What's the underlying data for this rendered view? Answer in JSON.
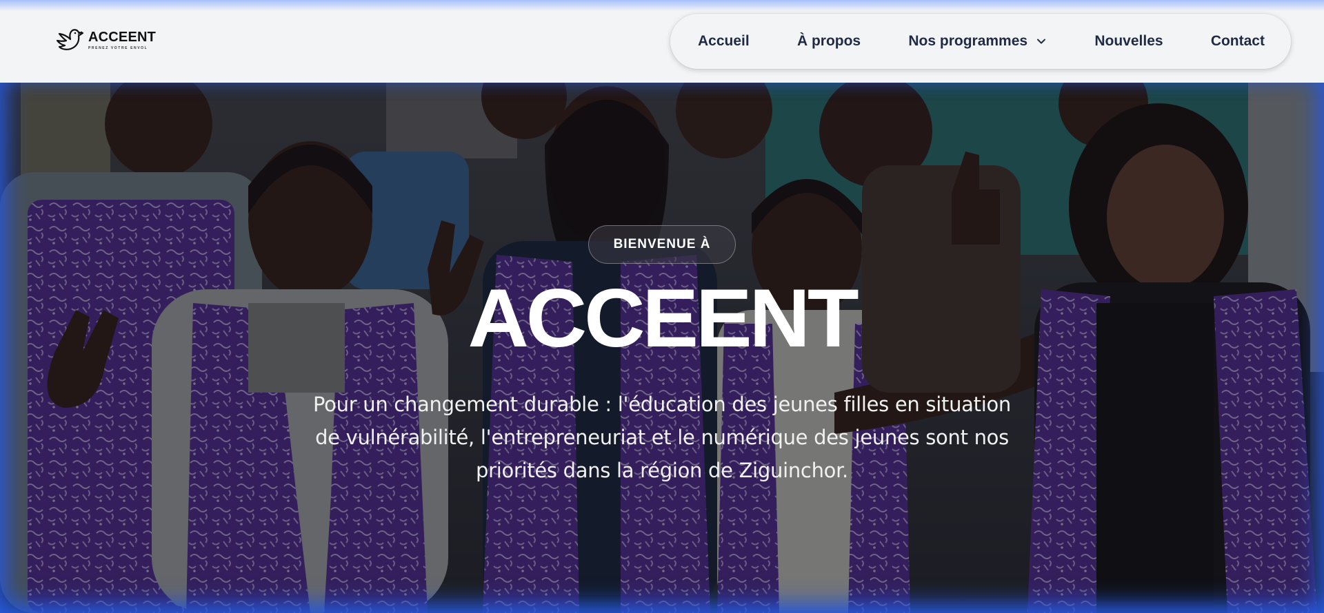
{
  "header": {
    "logo": {
      "name": "ACCEENT",
      "tagline": "PRENEZ VOTRE ENVOL",
      "icon": "dove-icon"
    },
    "nav": [
      {
        "label": "Accueil"
      },
      {
        "label": "À propos"
      },
      {
        "label": "Nos programmes",
        "icon": "chevron-down-icon"
      },
      {
        "label": "Nouvelles"
      },
      {
        "label": "Contact"
      }
    ]
  },
  "hero": {
    "badge": "BIENVENUE À",
    "title": "ACCEENT",
    "subtitle": "Pour un changement durable : l'éducation des jeunes filles en situation de vulnérabilité, l'entrepreneuriat et le numérique des jeunes sont nos priorités dans la région de Ziguinchor.",
    "image": "group-photo"
  },
  "colors": {
    "header_bg": "#f3f4f6",
    "nav_text": "#1f2a44",
    "hero_text": "#ffffff",
    "edge_glow": "#2855dc",
    "vest_purple": "#6a3fb0"
  }
}
